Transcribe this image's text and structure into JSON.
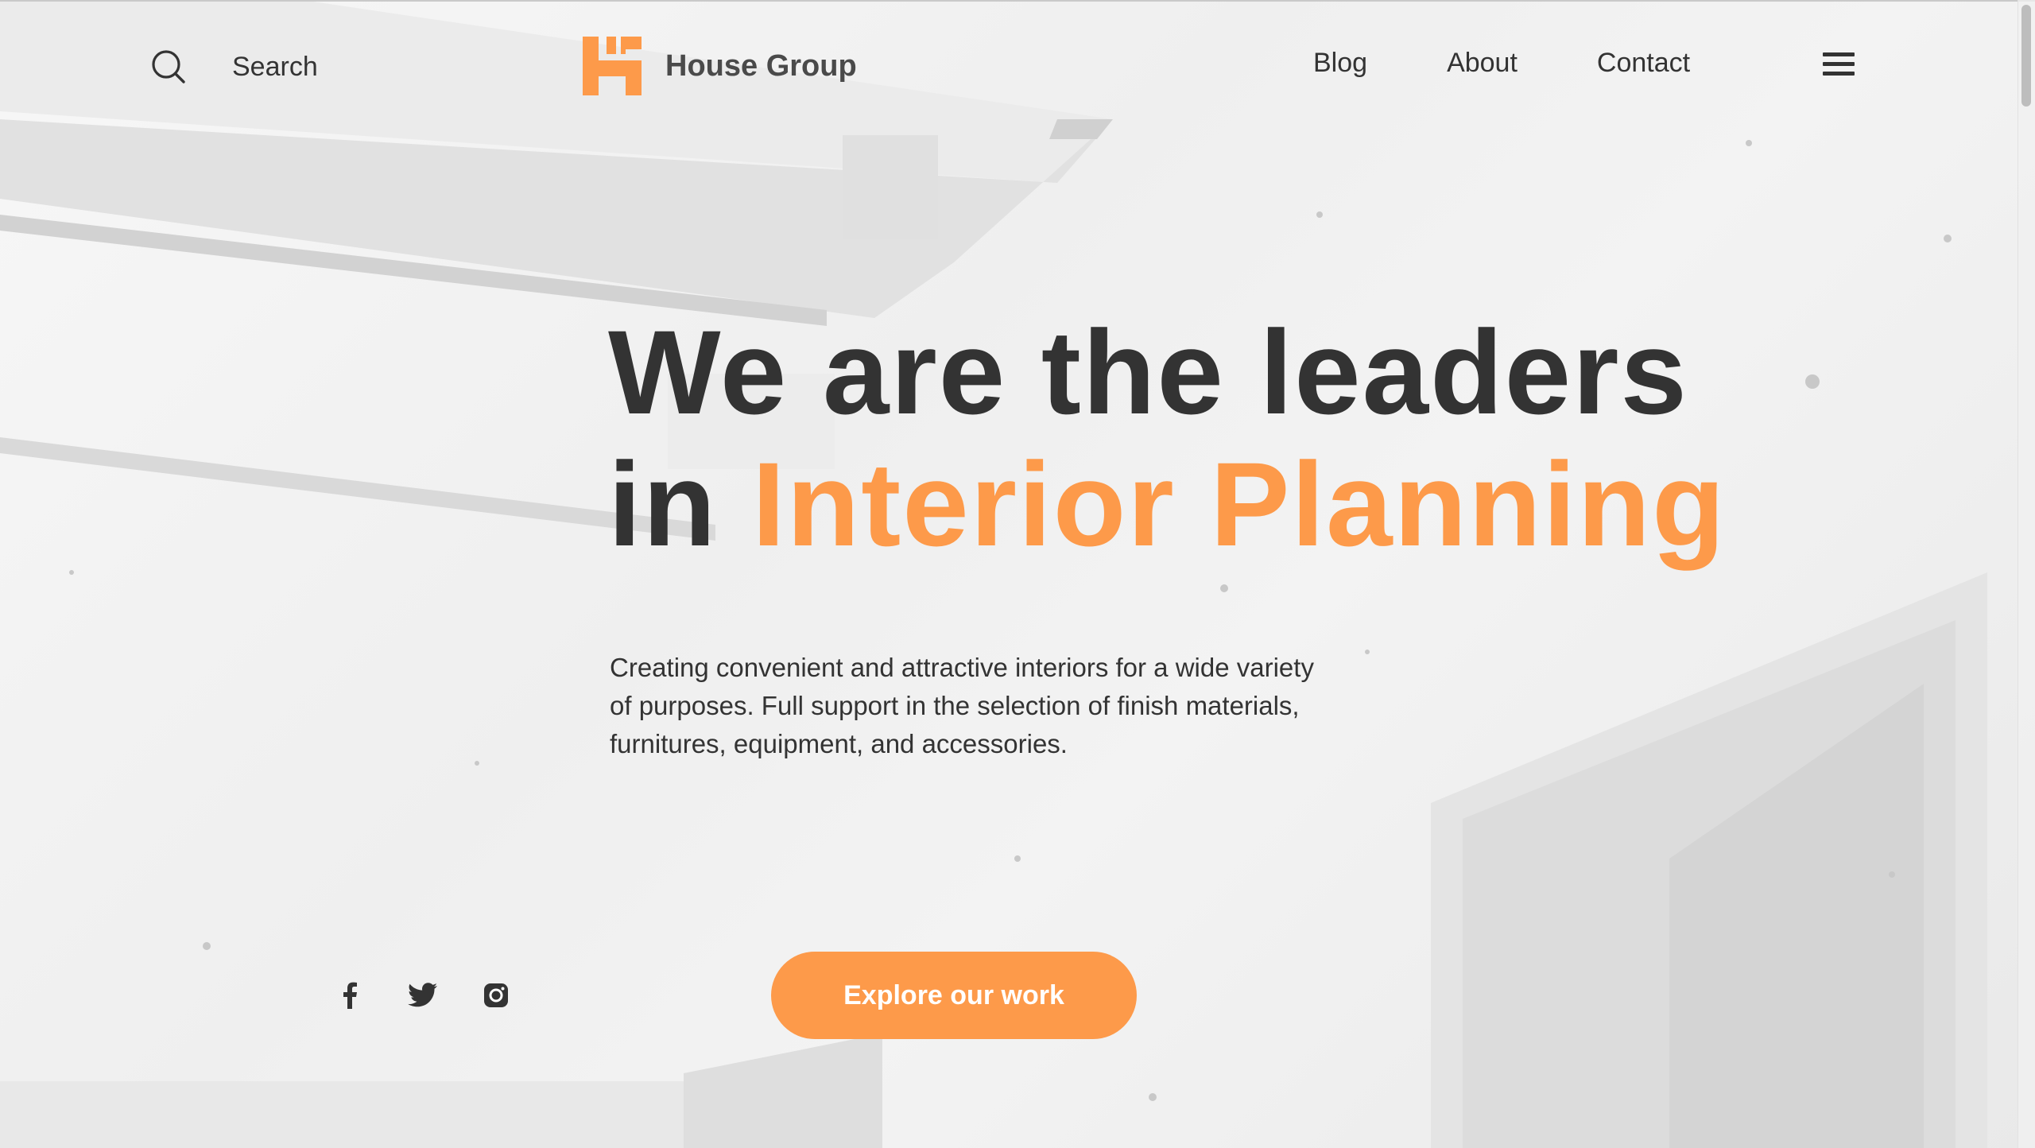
{
  "header": {
    "search_label": "Search",
    "brand_name": "House Group",
    "nav": [
      {
        "label": "Blog"
      },
      {
        "label": "About"
      },
      {
        "label": "Contact"
      }
    ]
  },
  "hero": {
    "headline_line1": "We are the leaders",
    "headline_in": "in",
    "headline_accent": "Interior Planning",
    "lead": "Creating convenient and attractive interiors for a wide variety of purposes. Full support in the selection of finish materials, furnitures, equipment, and accessories.",
    "cta_label": "Explore our work"
  },
  "social": [
    "facebook-icon",
    "twitter-icon",
    "instagram-icon"
  ],
  "colors": {
    "accent": "#fd9a4a",
    "text": "#333333",
    "background": "#f2f2f2"
  }
}
